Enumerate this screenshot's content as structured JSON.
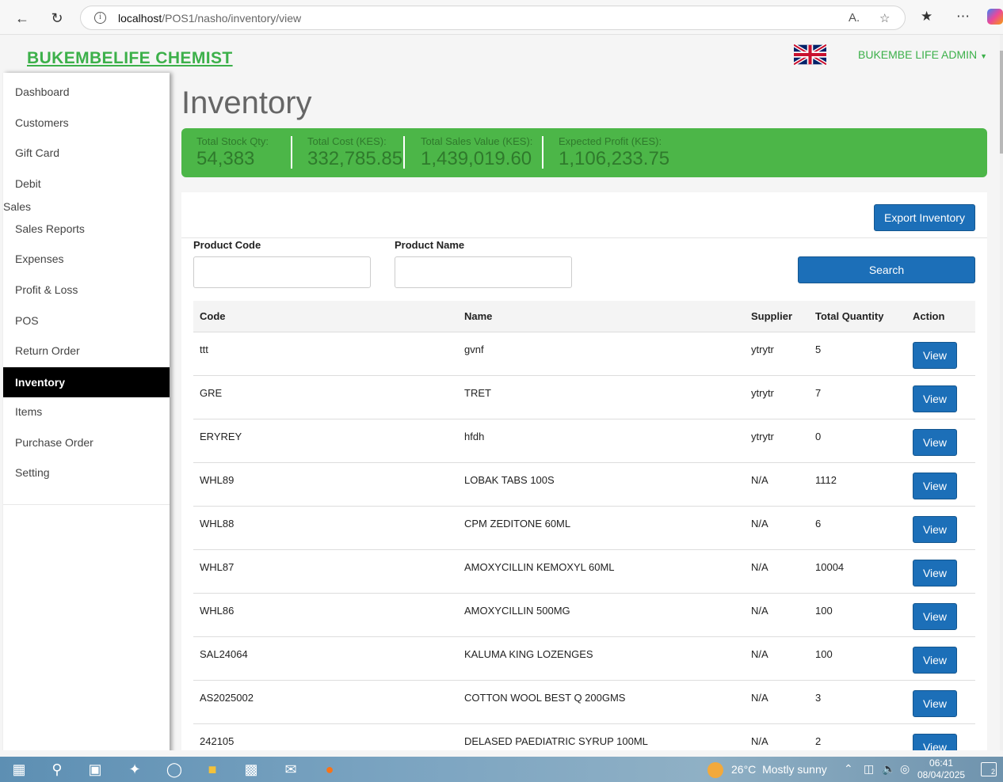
{
  "browser": {
    "url_host": "localhost",
    "url_path": "/POS1/nasho/inventory/view"
  },
  "header": {
    "brand": "BUKEMBELIFE CHEMIST",
    "admin": "BUKEMBE LIFE ADMIN"
  },
  "sidebar": {
    "items": [
      {
        "label": "Dashboard"
      },
      {
        "label": "Customers"
      },
      {
        "label": "Gift Card"
      },
      {
        "label": "Debit"
      },
      {
        "label": "Sales"
      },
      {
        "label": "Sales Reports"
      },
      {
        "label": "Expenses"
      },
      {
        "label": "Profit & Loss"
      },
      {
        "label": "POS"
      },
      {
        "label": "Return Order"
      },
      {
        "label": "Inventory"
      },
      {
        "label": "Items"
      },
      {
        "label": "Purchase Order"
      },
      {
        "label": "Setting"
      }
    ]
  },
  "page": {
    "title": "Inventory"
  },
  "stats": [
    {
      "label": "Total Stock Qty:",
      "value": "54,383"
    },
    {
      "label": "Total Cost (KES):",
      "value": "332,785.85"
    },
    {
      "label": "Total Sales Value (KES):",
      "value": "1,439,019.60"
    },
    {
      "label": "Expected Profit (KES):",
      "value": "1,106,233.75"
    }
  ],
  "filters": {
    "export_label": "Export Inventory",
    "code_label": "Product Code",
    "name_label": "Product Name",
    "code_value": "",
    "name_value": "",
    "search_label": "Search"
  },
  "table": {
    "headers": {
      "code": "Code",
      "name": "Name",
      "supplier": "Supplier",
      "qty": "Total Quantity",
      "action": "Action"
    },
    "view_label": "View",
    "rows": [
      {
        "code": "ttt",
        "name": "gvnf",
        "supplier": "ytrytr",
        "qty": "5"
      },
      {
        "code": "GRE",
        "name": "TRET",
        "supplier": "ytrytr",
        "qty": "7"
      },
      {
        "code": "ERYREY",
        "name": "hfdh",
        "supplier": "ytrytr",
        "qty": "0"
      },
      {
        "code": "WHL89",
        "name": "LOBAK TABS 100S",
        "supplier": "N/A",
        "qty": "1112"
      },
      {
        "code": "WHL88",
        "name": "CPM ZEDITONE 60ML",
        "supplier": "N/A",
        "qty": "6"
      },
      {
        "code": "WHL87",
        "name": "AMOXYCILLIN KEMOXYL 60ML",
        "supplier": "N/A",
        "qty": "10004"
      },
      {
        "code": "WHL86",
        "name": "AMOXYCILLIN 500MG",
        "supplier": "N/A",
        "qty": "100"
      },
      {
        "code": "SAL24064",
        "name": "KALUMA KING LOZENGES",
        "supplier": "N/A",
        "qty": "100"
      },
      {
        "code": "AS2025002",
        "name": "COTTON WOOL BEST Q 200GMS",
        "supplier": "N/A",
        "qty": "3"
      },
      {
        "code": "242105",
        "name": "DELASED PAEDIATRIC SYRUP 100ML",
        "supplier": "N/A",
        "qty": "2"
      }
    ]
  },
  "taskbar": {
    "temperature": "26°C",
    "weather": "Mostly sunny",
    "time": "06:41",
    "date": "08/04/2025",
    "notifications": "2"
  }
}
